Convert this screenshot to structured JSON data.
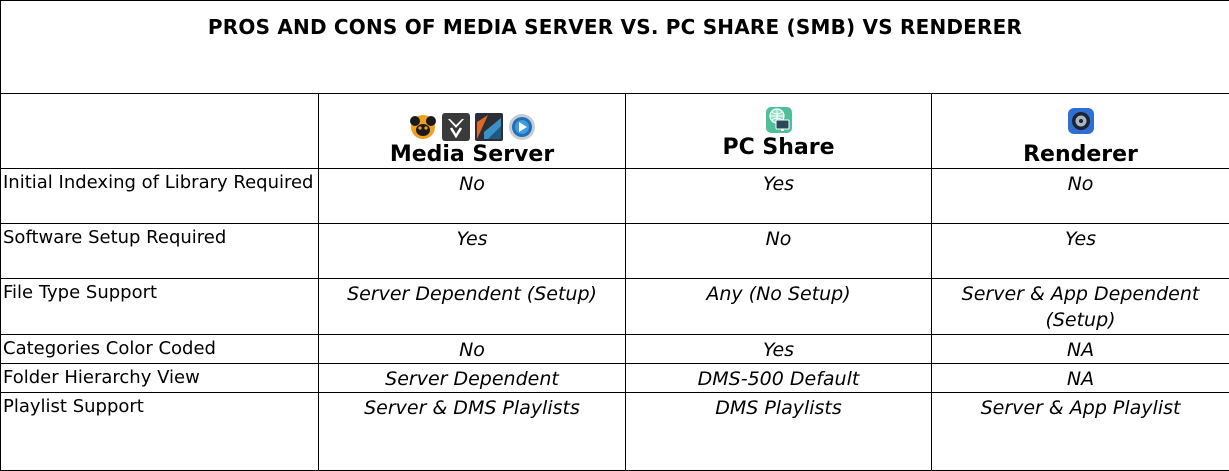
{
  "title": "PROS AND CONS OF MEDIA SERVER VS. PC SHARE (SMB) VS RENDERER",
  "columns": [
    {
      "label": "Media Server",
      "icons": [
        "mediamonkey-icon",
        "plex-icon",
        "kodi-icon",
        "windows-media-player-icon"
      ]
    },
    {
      "label": "PC Share",
      "icons": [
        "network-pc-icon"
      ]
    },
    {
      "label": "Renderer",
      "icons": [
        "speaker-app-icon"
      ]
    }
  ],
  "rows": [
    {
      "feature": "Initial Indexing of Library Required",
      "values": [
        "No",
        "Yes",
        "No"
      ]
    },
    {
      "feature": "Software Setup Required",
      "values": [
        "Yes",
        "No",
        "Yes"
      ]
    },
    {
      "feature": "File Type Support",
      "values": [
        "Server Dependent (Setup)",
        "Any (No Setup)",
        "Server & App Dependent (Setup)"
      ]
    },
    {
      "feature": "Categories Color Coded",
      "values": [
        "No",
        "Yes",
        "NA"
      ]
    },
    {
      "feature": "Folder Hierarchy View",
      "values": [
        "Server Dependent",
        "DMS-500 Default",
        "NA"
      ]
    },
    {
      "feature": "Playlist Support",
      "values": [
        "Server & DMS Playlists",
        "DMS Playlists",
        "Server & App Playlist"
      ]
    }
  ]
}
